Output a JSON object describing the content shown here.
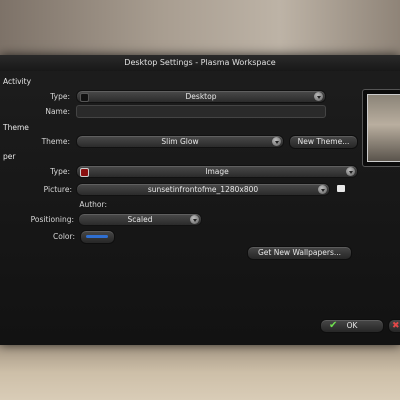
{
  "window": {
    "title": "Desktop Settings - Plasma Workspace"
  },
  "activity": {
    "section_label": "Activity",
    "type_label": "Type:",
    "type_value": "Desktop",
    "name_label": "Name:",
    "name_value": ""
  },
  "theme": {
    "section_label": "Theme",
    "theme_label": "Theme:",
    "theme_value": "Slim Glow",
    "new_theme_button": "New Theme..."
  },
  "wallpaper": {
    "section_label": "per",
    "type_label": "Type:",
    "type_value": "Image",
    "picture_label": "Picture:",
    "picture_value": "sunsetinfrontofme_1280x800",
    "author_label": "Author:",
    "author_value": "",
    "positioning_label": "Positioning:",
    "positioning_value": "Scaled",
    "color_label": "Color:",
    "color_swatch": "#2f6fd1",
    "get_new_button": "Get New Wallpapers..."
  },
  "footer": {
    "ok_label": "OK"
  }
}
